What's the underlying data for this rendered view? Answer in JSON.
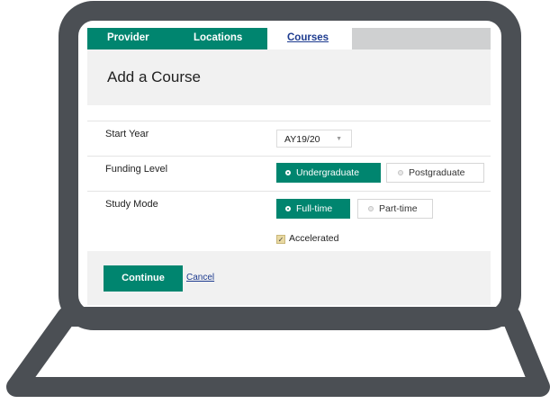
{
  "tabs": [
    {
      "label": "Provider",
      "active": false
    },
    {
      "label": "Locations",
      "active": false
    },
    {
      "label": "Courses",
      "active": true
    }
  ],
  "page": {
    "title": "Add a Course"
  },
  "form": {
    "start_year": {
      "label": "Start Year",
      "value": "AY19/20"
    },
    "funding_level": {
      "label": "Funding Level",
      "options": [
        "Undergraduate",
        "Postgraduate"
      ],
      "selected": "Undergraduate"
    },
    "study_mode": {
      "label": "Study Mode",
      "options": [
        "Full-time",
        "Part-time"
      ],
      "selected": "Full-time"
    },
    "accelerated": {
      "label": "Accelerated",
      "checked": true
    }
  },
  "actions": {
    "continue_label": "Continue",
    "cancel_label": "Cancel"
  },
  "colors": {
    "brand": "#00856f",
    "link": "#1d3b8f",
    "laptop": "#4b4f54",
    "panel": "#f1f1f1"
  },
  "icons": {
    "select_caret": "chevron-down-icon",
    "checkbox_mark": "checkmark-icon",
    "radio": "radio-icon"
  }
}
